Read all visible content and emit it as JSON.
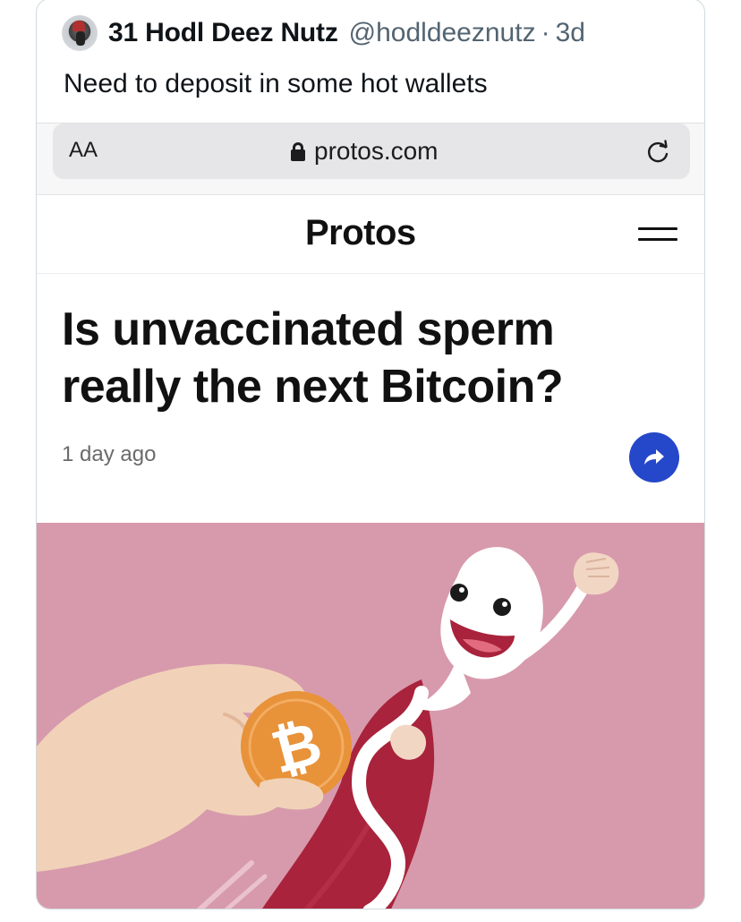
{
  "tweet": {
    "display_name": "31 Hodl Deez Nutz",
    "handle": "@hodldeeznutz",
    "separator": "·",
    "age": "3d",
    "text": "Need to deposit in some hot wallets"
  },
  "browser": {
    "text_size_label": "AA",
    "domain": "protos.com",
    "icons": [
      "lock-icon",
      "reload-icon"
    ]
  },
  "site": {
    "logo": "Protos",
    "menu_icon": "hamburger-icon"
  },
  "article": {
    "headline": "Is unvaccinated sperm really the next Bitcoin?",
    "age": "1 day ago",
    "share_icon": "share-arrow-icon",
    "share_color": "#2547c9"
  },
  "hero": {
    "background": "#d79aac",
    "coin_symbol": "₿",
    "coin_color": "#e8923a"
  }
}
